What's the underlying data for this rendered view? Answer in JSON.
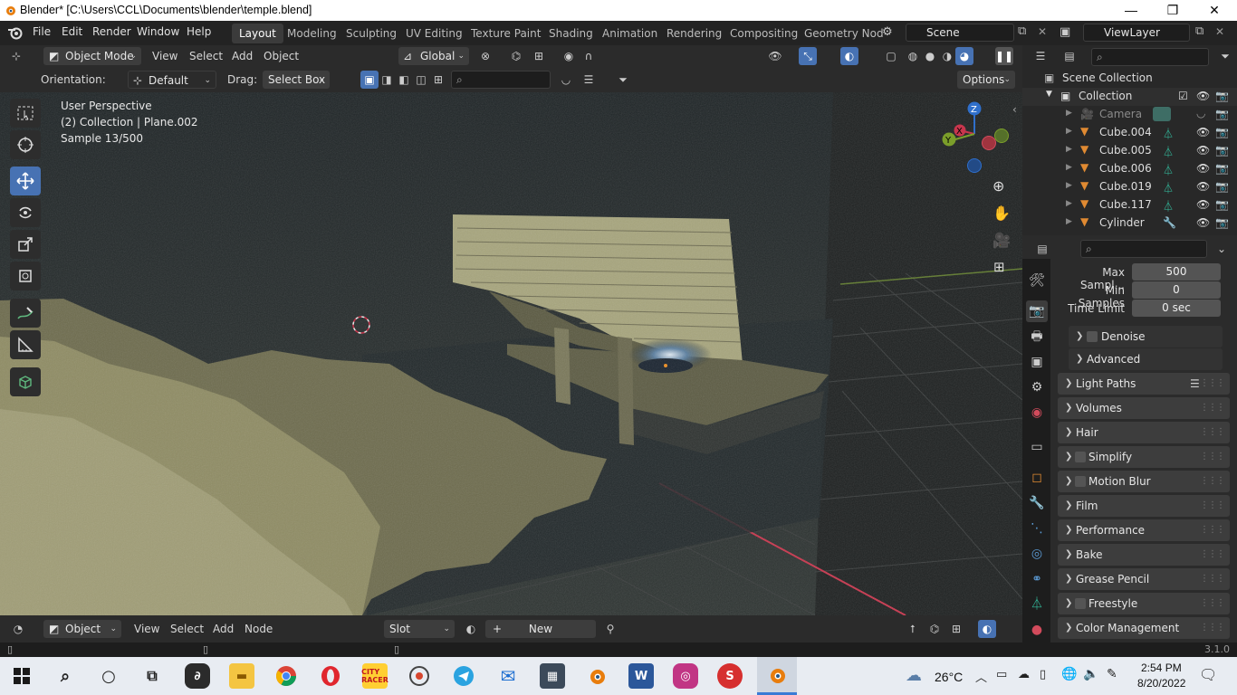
{
  "window": {
    "title": "Blender* [C:\\Users\\CCL\\Documents\\blender\\temple.blend]"
  },
  "menu": [
    "File",
    "Edit",
    "Render",
    "Window",
    "Help"
  ],
  "workspaces": [
    "Layout",
    "Modeling",
    "Sculpting",
    "UV Editing",
    "Texture Paint",
    "Shading",
    "Animation",
    "Rendering",
    "Compositing",
    "Geometry Nod"
  ],
  "scene": "Scene",
  "view_layer": "ViewLayer",
  "viewport_header": {
    "mode": "Object Mode",
    "menus": [
      "View",
      "Select",
      "Add",
      "Object"
    ],
    "transform": "Global"
  },
  "tool_settings": {
    "orientation_label": "Orientation:",
    "orientation": "Default",
    "drag_label": "Drag:",
    "drag": "Select Box",
    "options": "Options"
  },
  "overlay": {
    "view": "User Perspective",
    "collection": "(2) Collection | Plane.002",
    "sample": "Sample 13/500"
  },
  "gizmo": {
    "x": "X",
    "y": "Y",
    "z": "Z"
  },
  "outliner": {
    "scene_collection": "Scene Collection",
    "collection": "Collection",
    "items": [
      "Camera",
      "Cube.004",
      "Cube.005",
      "Cube.006",
      "Cube.019",
      "Cube.117",
      "Cylinder"
    ]
  },
  "properties": {
    "max_samples_label": "Max Sampl...",
    "max_samples": "500",
    "min_samples_label": "Min Samples",
    "min_samples": "0",
    "time_limit_label": "Time Limit",
    "time_limit": "0 sec",
    "denoise": "Denoise",
    "advanced": "Advanced",
    "panels": [
      "Light Paths",
      "Volumes",
      "Hair",
      "Simplify",
      "Motion Blur",
      "Film",
      "Performance",
      "Bake",
      "Grease Pencil",
      "Freestyle",
      "Color Management"
    ]
  },
  "bottom_header": {
    "object": "Object",
    "menus": [
      "View",
      "Select",
      "Add",
      "Node"
    ],
    "slot": "Slot",
    "new": "New"
  },
  "status": {
    "version": "3.1.0"
  },
  "taskbar": {
    "weather": "26°C",
    "time": "2:54 PM",
    "date": "8/20/2022"
  },
  "colors": {
    "accent": "#4772b3",
    "x_axis": "#c8364d",
    "y_axis": "#7b9e2a",
    "z_axis": "#2f6fcb",
    "mesh": "#b8b58a"
  }
}
